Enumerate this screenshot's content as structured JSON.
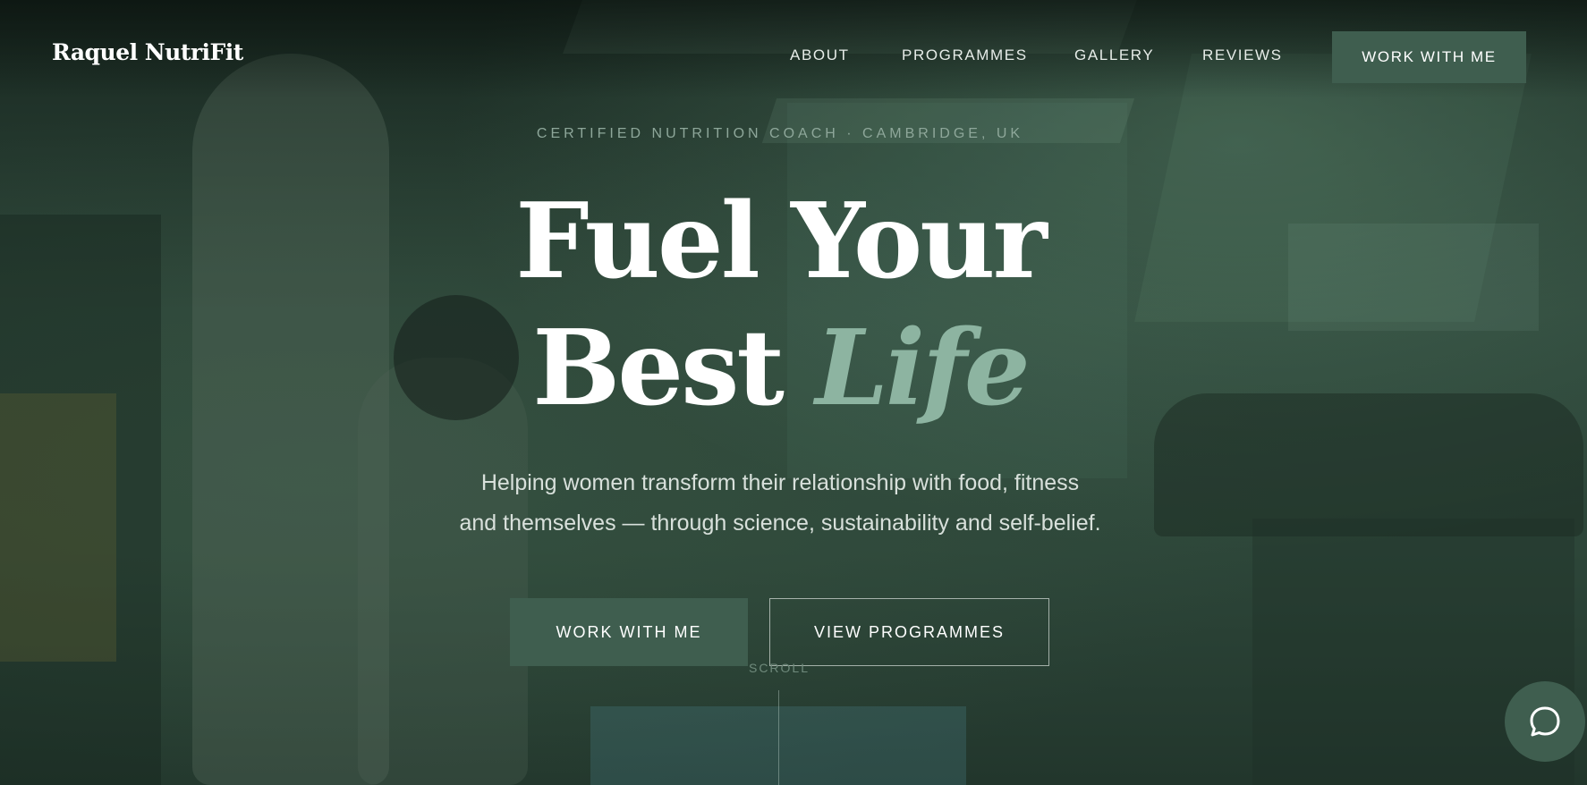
{
  "brand": {
    "name": "Raquel NutriFit"
  },
  "nav": {
    "links": [
      {
        "label": "ABOUT"
      },
      {
        "label": "PROGRAMMES"
      },
      {
        "label": "GALLERY"
      },
      {
        "label": "REVIEWS"
      }
    ],
    "cta_label": "WORK WITH ME"
  },
  "hero": {
    "eyebrow": "CERTIFIED NUTRITION COACH · CAMBRIDGE, UK",
    "headline_line1": "Fuel Your",
    "headline_line2_plain": "Best",
    "headline_line2_accent": "Life",
    "subtitle_line1": "Helping women transform their relationship with food, fitness",
    "subtitle_line2": "and themselves — through science, sustainability and self-belief.",
    "primary_button": "WORK WITH ME",
    "secondary_button": "VIEW PROGRAMMES",
    "scroll_label": "SCROLL"
  },
  "chat": {
    "icon": "chat-bubble-icon"
  },
  "colors": {
    "accent": "#3f5e4f",
    "headline_accent": "#8db4a1",
    "text": "#ffffff"
  }
}
